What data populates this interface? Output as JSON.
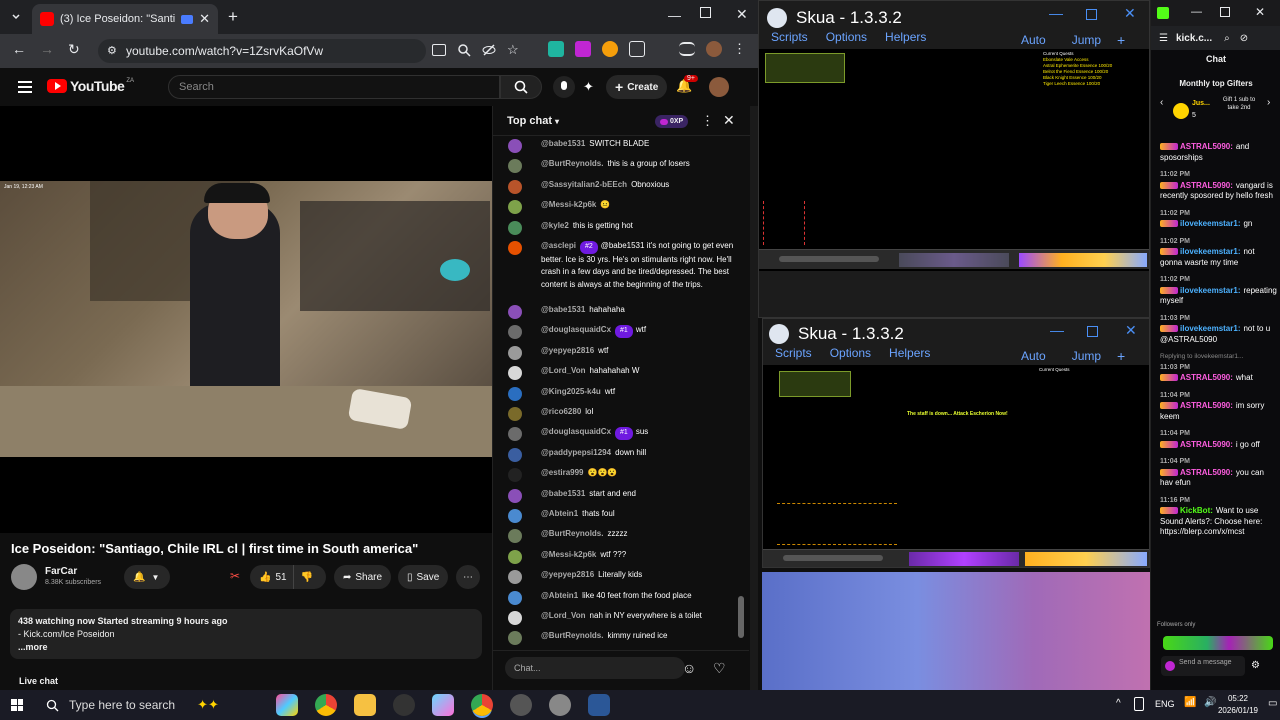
{
  "browser": {
    "tab_title": "(3) Ice Poseidon: \"Santiago,",
    "url": "youtube.com/watch?v=1ZsrvKaOfVw"
  },
  "youtube": {
    "logo_text": "YouTube",
    "country": "ZA",
    "search_placeholder": "Search",
    "create_label": "Create",
    "notif_count": "9+",
    "video": {
      "timestamp": "Jan 19, 12:23 AM",
      "title": "Ice Poseidon: \"Santiago, Chile IRL cl | first time in South america\"",
      "channel": "FarCar",
      "subscribers": "8.38K subscribers",
      "likes": "51",
      "share_label": "Share",
      "save_label": "Save",
      "desc_line1": "438 watching now  Started streaming 9 hours ago",
      "desc_line2": "- Kick.com/Ice Poseidon",
      "more": "...more",
      "live_chat": "Live chat"
    },
    "chat": {
      "header": "Top chat",
      "xp": "0XP",
      "input_placeholder": "Chat...",
      "messages": [
        {
          "user": "@babe1531",
          "text": "SWITCH BLADE",
          "color": "#8a4fb8"
        },
        {
          "user": "@BurtReynolds.",
          "text": "this is a group of losers",
          "color": "#6b7b5b"
        },
        {
          "user": "@Sassyitalian2-bEEch",
          "text": "Obnoxious",
          "color": "#b8542a"
        },
        {
          "user": "@Messi-k2p6k",
          "text": "😐",
          "color": "#7ea24a"
        },
        {
          "user": "@kyle2",
          "text": "this is getting hot",
          "color": "#4a8c5a"
        },
        {
          "user": "@asclepi",
          "badge": "#2",
          "text": "@babe1531 it's not going to get even better. Ice is 30 yrs. He's on stimulants right now. He'll crash in a few days and be tired/depressed. The best content is always at the beginning of the trips.",
          "color": "#e65100"
        },
        {
          "user": "@babe1531",
          "text": "hahahaha",
          "color": "#8a4fb8"
        },
        {
          "user": "@douglasquaidCx",
          "badge": "#1",
          "text": "wtf",
          "color": "#6b6b6b"
        },
        {
          "user": "@yepyep2816",
          "text": "wtf",
          "color": "#9a9a9a"
        },
        {
          "user": "@Lord_Von",
          "text": "hahahahah W",
          "color": "#d8d8d8"
        },
        {
          "user": "@King2025-k4u",
          "text": "wtf",
          "color": "#2a6ec0"
        },
        {
          "user": "@rico6280",
          "text": "lol",
          "color": "#7a6a2a"
        },
        {
          "user": "@douglasquaidCx",
          "badge": "#1",
          "text": "sus",
          "color": "#6b6b6b"
        },
        {
          "user": "@paddypepsi1294",
          "text": "down hill",
          "color": "#3a5ea0"
        },
        {
          "user": "@estira999",
          "text": "😮😮😮",
          "color": "#222222"
        },
        {
          "user": "@babe1531",
          "text": "start and end",
          "color": "#8a4fb8"
        },
        {
          "user": "@Abtein1",
          "text": "thats foul",
          "color": "#4a8ad0"
        },
        {
          "user": "@BurtReynolds.",
          "text": "zzzzz",
          "color": "#6b7b5b"
        },
        {
          "user": "@Messi-k2p6k",
          "text": "wtf ???",
          "color": "#7ea24a"
        },
        {
          "user": "@yepyep2816",
          "text": "Literally kids",
          "color": "#9a9a9a"
        },
        {
          "user": "@Abtein1",
          "text": "like 40 feet from the food place",
          "color": "#4a8ad0"
        },
        {
          "user": "@Lord_Von",
          "text": "nah in NY everywhere is a toilet",
          "color": "#d8d8d8"
        },
        {
          "user": "@BurtReynolds.",
          "text": "kimmy ruined ice",
          "color": "#6b7b5b"
        }
      ]
    }
  },
  "skua1": {
    "title": "Skua - 1.3.3.2",
    "menu": [
      "Scripts",
      "Options",
      "Helpers"
    ],
    "auto": "Auto",
    "jump": "Jump",
    "quests_title": "Current Quests",
    "quests": [
      "Ebonslate Vale Access",
      "Astral Ephemerite Essence 100/20",
      "Belrot the Fiend Essence 100/20",
      "Black Knight Essence 100/20",
      "Tiger Leech Essence 100/20"
    ]
  },
  "skua2": {
    "title": "Skua - 1.3.3.2",
    "menu": [
      "Scripts",
      "Options",
      "Helpers"
    ],
    "auto": "Auto",
    "jump": "Jump",
    "quests_title": "Current Quests",
    "game_msg": "The staff is down... Attack Escherion Now!"
  },
  "kick": {
    "url": "kick.c...",
    "chat_label": "Chat",
    "gifters_label": "Monthly top Gifters",
    "gifter_name": "Jus...",
    "gifter_count": "5",
    "gift_text": "Gift 1 sub to take 2nd",
    "messages": [
      {
        "time": "",
        "user": "ASTRAL5090:",
        "text": "and sposorships",
        "cls": "u"
      },
      {
        "time": "11:02 PM",
        "user": "ASTRAL5090:",
        "text": "vangard is recently sposored by hello fresh",
        "cls": "u"
      },
      {
        "time": "11:02 PM",
        "user": "ilovekeemstar1:",
        "text": "gn",
        "cls": "u2"
      },
      {
        "time": "11:02 PM",
        "user": "ilovekeemstar1:",
        "text": "not gonna wasrte my time",
        "cls": "u2"
      },
      {
        "time": "11:02 PM",
        "user": "ilovekeemstar1:",
        "text": "repeating myself",
        "cls": "u2"
      },
      {
        "time": "11:03 PM",
        "user": "ilovekeemstar1:",
        "text": "not to u @ASTRAL5090",
        "cls": "u2"
      },
      {
        "time": "11:03 PM",
        "user": "ASTRAL5090:",
        "text": "what",
        "cls": "u",
        "reply": "Replying to ilovekeemstar1..."
      },
      {
        "time": "11:04 PM",
        "user": "ASTRAL5090:",
        "text": "im sorry keem",
        "cls": "u"
      },
      {
        "time": "11:04 PM",
        "user": "ASTRAL5090:",
        "text": "i go off",
        "cls": "u"
      },
      {
        "time": "11:04 PM",
        "user": "ASTRAL5090:",
        "text": "you can hav efun",
        "cls": "u"
      },
      {
        "time": "11:16 PM",
        "user": "KickBot:",
        "text": "Want to use Sound Alerts?: Choose here: https://blerp.com/x/mcst",
        "cls": "u3"
      }
    ],
    "followers_only": "Followers only",
    "send_placeholder": "Send a message"
  },
  "taskbar": {
    "search_placeholder": "Type here to search",
    "lang": "ENG",
    "time": "05:22",
    "date": "2026/01/19"
  }
}
